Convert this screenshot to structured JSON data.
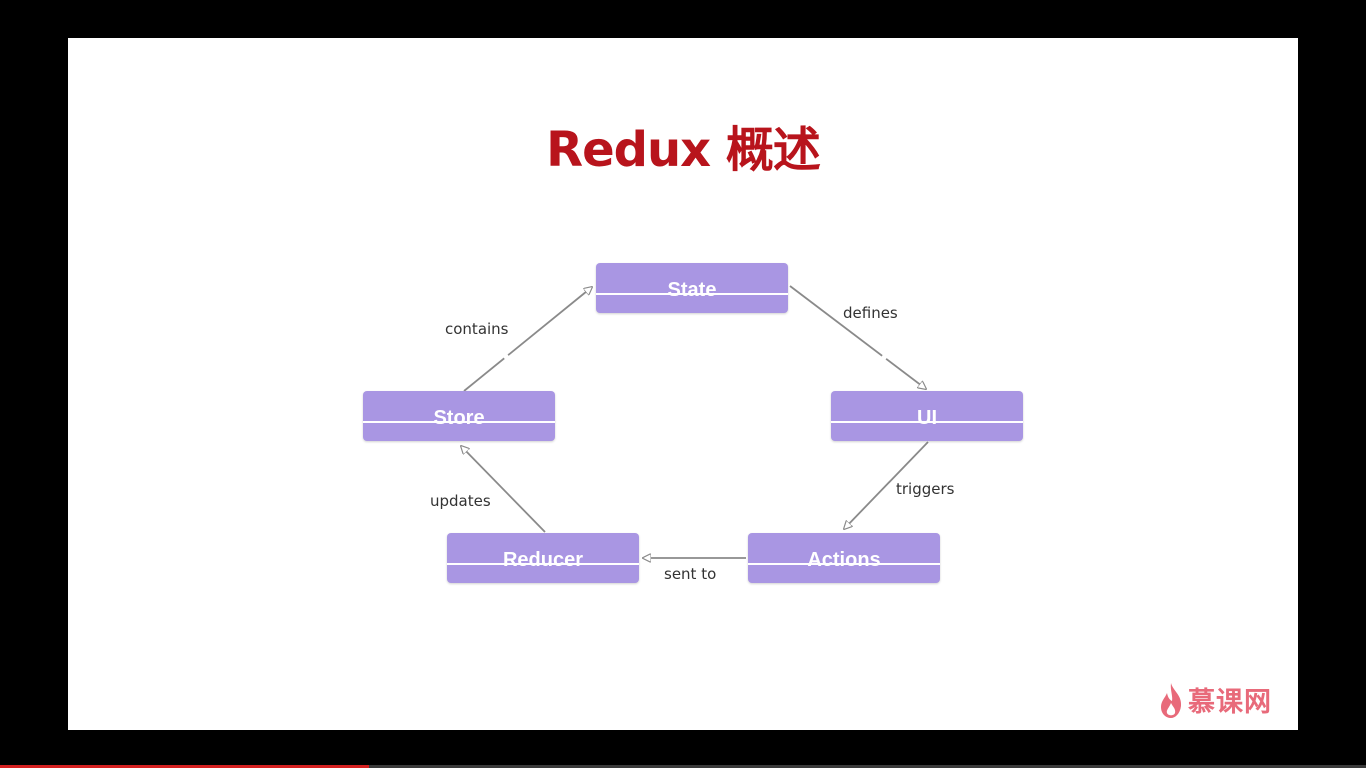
{
  "title": "Redux 概述",
  "nodes": {
    "state": "State",
    "ui": "UI",
    "actions": "Actions",
    "reducer": "Reducer",
    "store": "Store"
  },
  "edges": {
    "defines": "defines",
    "triggers": "triggers",
    "sent_to": "sent to",
    "updates": "updates",
    "contains": "contains"
  },
  "logo": {
    "text": "慕课网"
  },
  "player": {
    "progress": 0.27
  },
  "colors": {
    "title": "#b8141c",
    "node_fill": "#a996e3",
    "arrow": "#8a8a8a",
    "logo": "#e86a7a",
    "progress": "#d42020"
  }
}
